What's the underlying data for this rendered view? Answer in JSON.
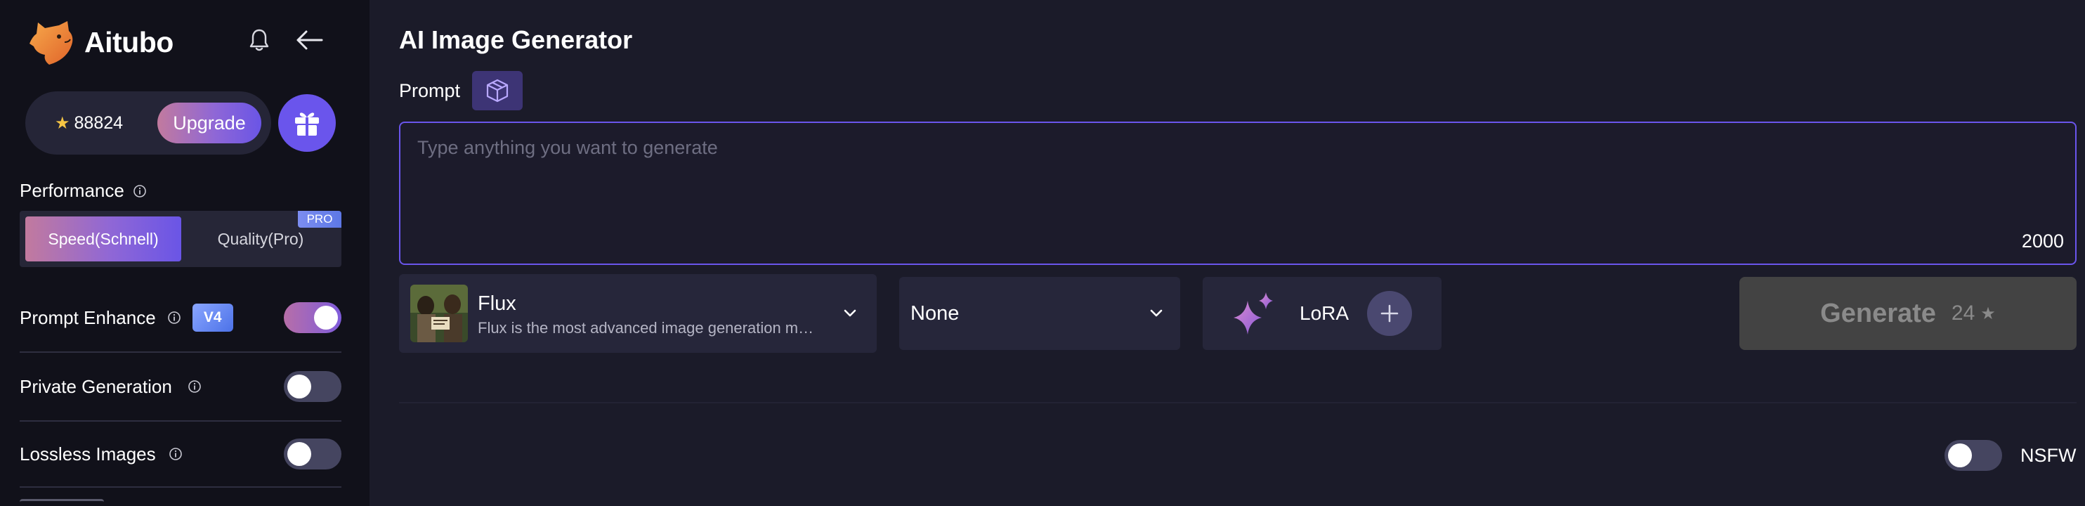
{
  "sidebar": {
    "brand": "Aitubo",
    "credits": {
      "star": "★",
      "value": "88824"
    },
    "upgrade_label": "Upgrade",
    "performance": {
      "label": "Performance",
      "options": [
        {
          "label": "Speed(Schnell)",
          "selected": true
        },
        {
          "label": "Quality(Pro)",
          "selected": false,
          "badge": "PRO"
        }
      ]
    },
    "options": [
      {
        "label": "Prompt Enhance",
        "badge": "V4",
        "enabled": true
      },
      {
        "label": "Private Generation",
        "enabled": false
      },
      {
        "label": "Lossless Images",
        "enabled": false
      }
    ]
  },
  "main": {
    "title": "AI Image Generator",
    "prompt_label": "Prompt",
    "prompt": {
      "value": "",
      "placeholder": "Type anything you want to generate",
      "max_chars": "2000"
    },
    "model": {
      "name": "Flux",
      "description": "Flux is the most advanced image generation model"
    },
    "style": {
      "value": "None"
    },
    "lora_label": "LoRA",
    "generate": {
      "label": "Generate",
      "cost": "24"
    },
    "nsfw": {
      "label": "NSFW",
      "enabled": false
    }
  },
  "colors": {
    "accent": "#6a55ec",
    "sidebar_bg": "#11111a",
    "main_bg": "#1b1b29",
    "panel_bg": "#26263a"
  },
  "icons": [
    "logo-icon",
    "bell-icon",
    "arrow-left-icon",
    "star-icon",
    "gift-icon",
    "info-icon",
    "cube-icon",
    "chevron-down-icon",
    "sparkle-icon",
    "plus-icon"
  ]
}
